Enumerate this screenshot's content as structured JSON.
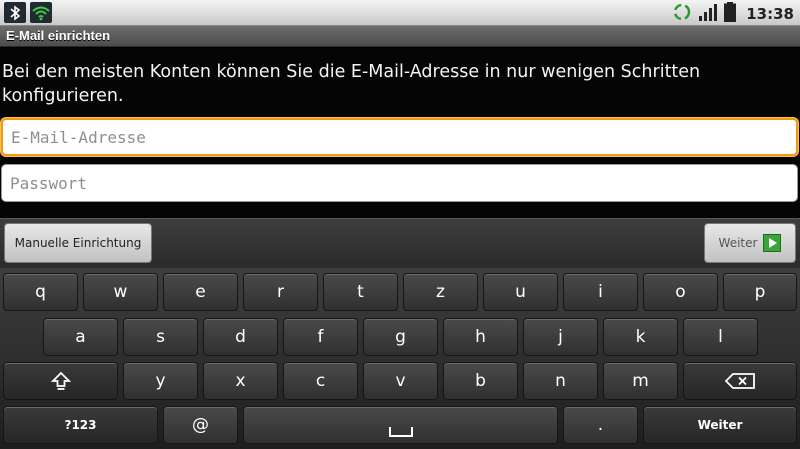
{
  "status_bar": {
    "time": "13:38",
    "icons": [
      "bluetooth-icon",
      "wifi-icon",
      "sync-icon",
      "signal-strength-icon",
      "battery-icon"
    ]
  },
  "window": {
    "title": "E-Mail einrichten"
  },
  "setup": {
    "intro_text": "Bei den meisten Konten können Sie die E-Mail-Adresse in nur wenigen Schritten konfigurieren.",
    "email_placeholder": "E-Mail-Adresse",
    "email_value": "",
    "password_placeholder": "Passwort",
    "password_value": ""
  },
  "actions": {
    "manual_label": "Manuelle Einrichtung",
    "next_label": "Weiter"
  },
  "keyboard": {
    "row1": [
      "q",
      "w",
      "e",
      "r",
      "t",
      "z",
      "u",
      "i",
      "o",
      "p"
    ],
    "row2": [
      "a",
      "s",
      "d",
      "f",
      "g",
      "h",
      "j",
      "k",
      "l"
    ],
    "row3": [
      "y",
      "x",
      "c",
      "v",
      "b",
      "n",
      "m"
    ],
    "symbols_label": "?123",
    "at_label": "@",
    "dot_label": ".",
    "enter_label": "Weiter"
  },
  "colors": {
    "focus_border": "#ee9a16",
    "next_arrow": "#3aa53a"
  }
}
